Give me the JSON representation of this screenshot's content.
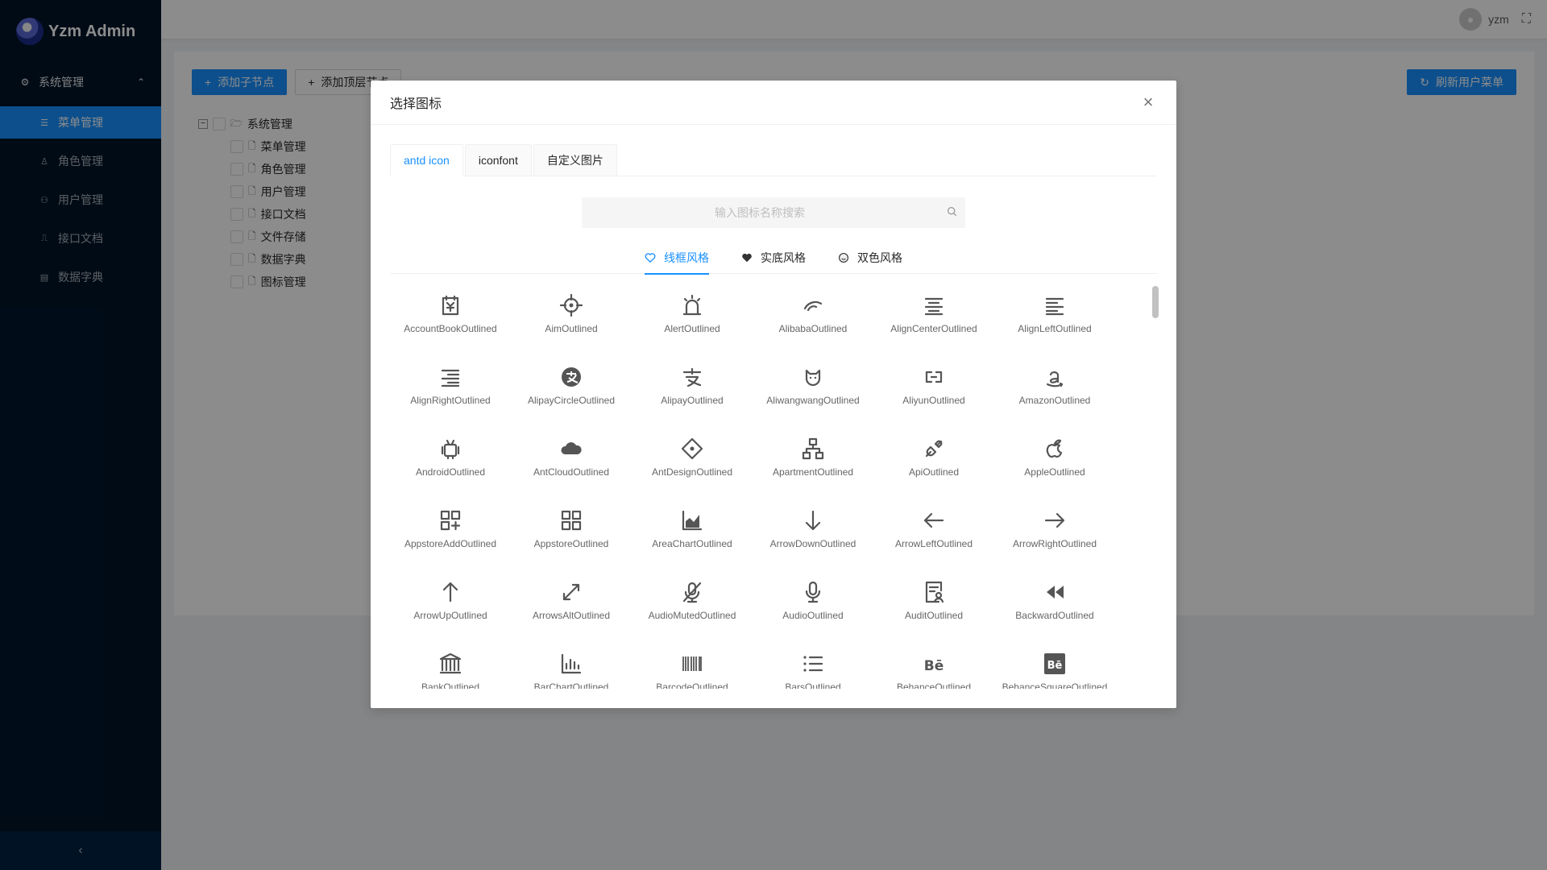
{
  "app": {
    "title": "Yzm Admin"
  },
  "sidebar": {
    "group": "系统管理",
    "items": [
      {
        "label": "菜单管理"
      },
      {
        "label": "角色管理"
      },
      {
        "label": "用户管理"
      },
      {
        "label": "接口文档"
      },
      {
        "label": "数据字典"
      }
    ]
  },
  "header": {
    "username": "yzm"
  },
  "toolbar": {
    "add_child": "添加子节点",
    "add_top": "添加顶层节点",
    "refresh": "刷新用户菜单"
  },
  "tree": {
    "root": "系统管理",
    "children": [
      "菜单管理",
      "角色管理",
      "用户管理",
      "接口文档",
      "文件存储",
      "数据字典",
      "图标管理"
    ]
  },
  "modal": {
    "title": "选择图标",
    "tabs": [
      "antd icon",
      "iconfont",
      "自定义图片"
    ],
    "search_placeholder": "输入图标名称搜索",
    "styles": [
      "线框风格",
      "实底风格",
      "双色风格"
    ],
    "icons": [
      "AccountBookOutlined",
      "AimOutlined",
      "AlertOutlined",
      "AlibabaOutlined",
      "AlignCenterOutlined",
      "AlignLeftOutlined",
      "AlignRightOutlined",
      "AlipayCircleOutlined",
      "AlipayOutlined",
      "AliwangwangOutlined",
      "AliyunOutlined",
      "AmazonOutlined",
      "AndroidOutlined",
      "AntCloudOutlined",
      "AntDesignOutlined",
      "ApartmentOutlined",
      "ApiOutlined",
      "AppleOutlined",
      "AppstoreAddOutlined",
      "AppstoreOutlined",
      "AreaChartOutlined",
      "ArrowDownOutlined",
      "ArrowLeftOutlined",
      "ArrowRightOutlined",
      "ArrowUpOutlined",
      "ArrowsAltOutlined",
      "AudioMutedOutlined",
      "AudioOutlined",
      "AuditOutlined",
      "BackwardOutlined",
      "BankOutlined",
      "BarChartOutlined",
      "BarcodeOutlined",
      "BarsOutlined",
      "BehanceOutlined",
      "BehanceSquareOutlined"
    ]
  },
  "colors": {
    "primary": "#1890ff",
    "sider": "#001529"
  }
}
